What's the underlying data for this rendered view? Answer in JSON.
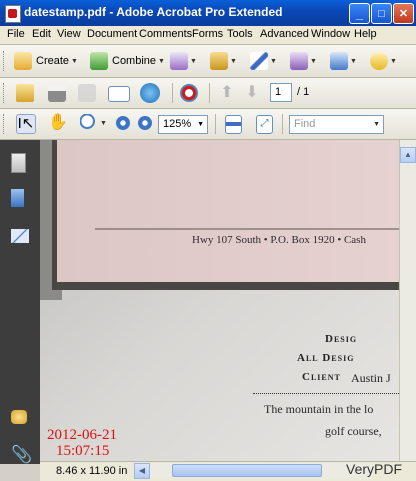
{
  "window": {
    "title": "datestamp.pdf - Adobe Acrobat Pro Extended",
    "controls": {
      "minimize": "_",
      "maximize": "□",
      "close": "✕"
    }
  },
  "menu": [
    "File",
    "Edit",
    "View",
    "Document",
    "Comments",
    "Forms",
    "Tools",
    "Advanced",
    "Window",
    "Help"
  ],
  "toolbar1": {
    "create_label": "Create",
    "combine_label": "Combine"
  },
  "toolbar2": {
    "page_current": "1",
    "page_total": "/ 1"
  },
  "toolbar3": {
    "zoom_value": "125%",
    "find_placeholder": "Find"
  },
  "document": {
    "address_line": "Hwy 107 South  •  P.O. Box 1920  •  Cash",
    "heading_1": "Desig",
    "heading_2": "All Desig",
    "client_label": "Client",
    "client_value": "Austin J",
    "body_line_1": "The mountain in the lo",
    "body_line_2": "golf course,"
  },
  "stamp": {
    "date": "2012-06-21",
    "time": "15:07:15",
    "color": "#e01010"
  },
  "status": {
    "page_size": "8.46 x 11.90 in"
  },
  "watermark": "VeryPDF",
  "colors": {
    "titlebar": "#0b49b8",
    "leftnav": "#3d3d3d",
    "bullet": "#c4161c"
  }
}
